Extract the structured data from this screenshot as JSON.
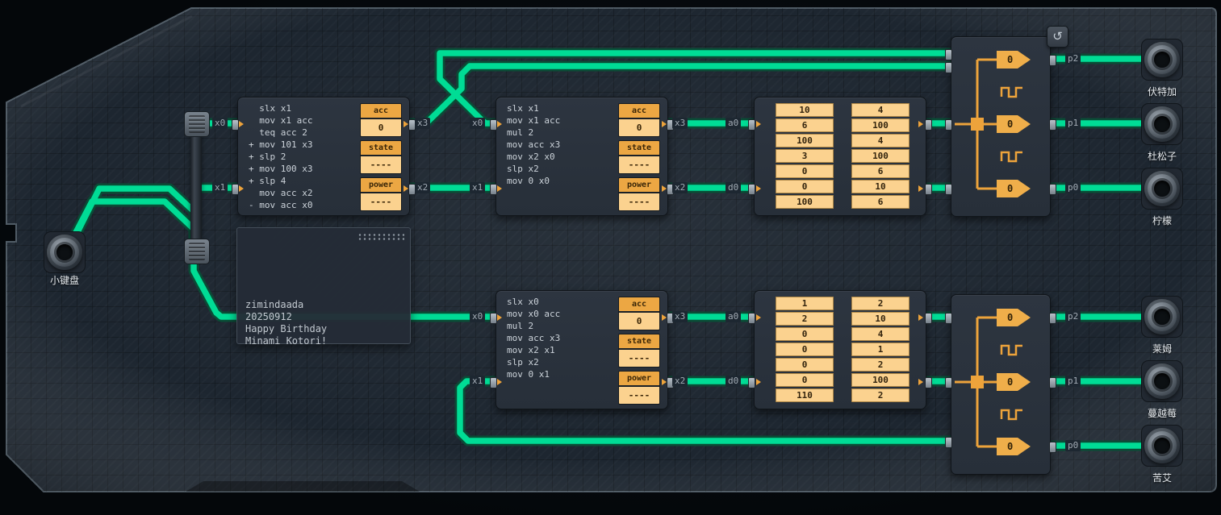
{
  "ui": {
    "reset_icon": "↺"
  },
  "note": {
    "lines": [
      "zimindaada",
      "20250912",
      "Happy Birthday",
      "Minami Kotori!"
    ]
  },
  "connectors": {
    "input": {
      "label": "小键盘"
    },
    "top_outputs": [
      {
        "label": "伏特加"
      },
      {
        "label": "杜松子"
      },
      {
        "label": "柠檬"
      }
    ],
    "bottom_outputs": [
      {
        "label": "莱姆"
      },
      {
        "label": "蔓越莓"
      },
      {
        "label": "苦艾"
      }
    ]
  },
  "mcs": [
    {
      "code": [
        "  slx x1",
        "  mov x1 acc",
        "  teq acc 2",
        "+ mov 101 x3",
        "+ slp 2",
        "+ mov 100 x3",
        "+ slp 4",
        "  mov acc x2",
        "- mov acc x0"
      ],
      "registers": [
        {
          "label": "acc",
          "value": "0"
        },
        {
          "label": "state",
          "value": "----"
        },
        {
          "label": "power",
          "value": "----"
        }
      ]
    },
    {
      "code": [
        "slx x1",
        "mov x1 acc",
        "mul 2",
        "mov acc x3",
        "mov x2 x0",
        "slp x2",
        "mov 0 x0"
      ],
      "registers": [
        {
          "label": "acc",
          "value": "0"
        },
        {
          "label": "state",
          "value": "----"
        },
        {
          "label": "power",
          "value": "----"
        }
      ]
    },
    {
      "code": [
        "slx x0",
        "mov x0 acc",
        "mul 2",
        "mov acc x3",
        "mov x2 x1",
        "slp x2",
        "mov 0 x1"
      ],
      "registers": [
        {
          "label": "acc",
          "value": "0"
        },
        {
          "label": "state",
          "value": "----"
        },
        {
          "label": "power",
          "value": "----"
        }
      ]
    }
  ],
  "rams": [
    {
      "col1": [
        "10",
        "6",
        "100",
        "3",
        "0",
        "0",
        "100"
      ],
      "col2": [
        "4",
        "100",
        "4",
        "100",
        "6",
        "10",
        "6"
      ]
    },
    {
      "col1": [
        "1",
        "2",
        "0",
        "0",
        "0",
        "0",
        "110"
      ],
      "col2": [
        "2",
        "10",
        "4",
        "1",
        "2",
        "100",
        "2"
      ]
    }
  ],
  "expanders": [
    {
      "gates": [
        "0",
        "0",
        "0"
      ]
    },
    {
      "gates": [
        "0",
        "0",
        "0"
      ]
    }
  ],
  "pin_labels": {
    "mc1_in_a": "x0",
    "mc1_in_b": "x1",
    "mc1_out_a": "x3",
    "mc1_out_b": "x2",
    "mc2_in_a": "x0",
    "mc2_in_b": "x1",
    "mc2_out_a": "x3",
    "mc2_out_b": "x2",
    "ram1_a": "a0",
    "ram1_d": "d0",
    "exp1_p2": "p2",
    "exp1_p1": "p1",
    "exp1_p0": "p0",
    "mc3_in_a": "x0",
    "mc3_in_b": "x1",
    "mc3_out_a": "x3",
    "mc3_out_b": "x2",
    "ram2_a": "a0",
    "ram2_d": "d0",
    "exp2_p2": "p2",
    "exp2_p1": "p1",
    "exp2_p0": "p0"
  }
}
